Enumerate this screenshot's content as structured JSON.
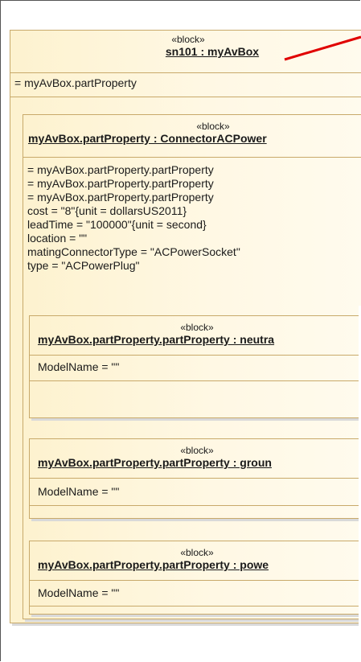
{
  "outer_block": {
    "stereotype": "«block»",
    "name": "sn101 : myAvBox",
    "attributes": [
      "= myAvBox.partProperty"
    ]
  },
  "connector_block": {
    "stereotype": "«block»",
    "name": "myAvBox.partProperty : ConnectorACPower",
    "attributes": [
      "= myAvBox.partProperty.partProperty",
      "= myAvBox.partProperty.partProperty",
      "= myAvBox.partProperty.partProperty",
      "cost = \"8\"{unit = dollarsUS2011}",
      "leadTime = \"100000\"{unit = second}",
      "location = \"\"",
      "matingConnectorType = \"ACPowerSocket\"",
      "type = \"ACPowerPlug\""
    ]
  },
  "nested_blocks": [
    {
      "stereotype": "«block»",
      "name": "myAvBox.partProperty.partProperty : neutra",
      "attribute": "ModelName = \"\""
    },
    {
      "stereotype": "«block»",
      "name": "myAvBox.partProperty.partProperty : groun",
      "attribute": "ModelName = \"\""
    },
    {
      "stereotype": "«block»",
      "name": "myAvBox.partProperty.partProperty : powe",
      "attribute": "ModelName = \"\""
    }
  ],
  "colors": {
    "block_border": "#c8a96a",
    "block_fill": "#fdf2cf",
    "link_line": "#e00000"
  }
}
